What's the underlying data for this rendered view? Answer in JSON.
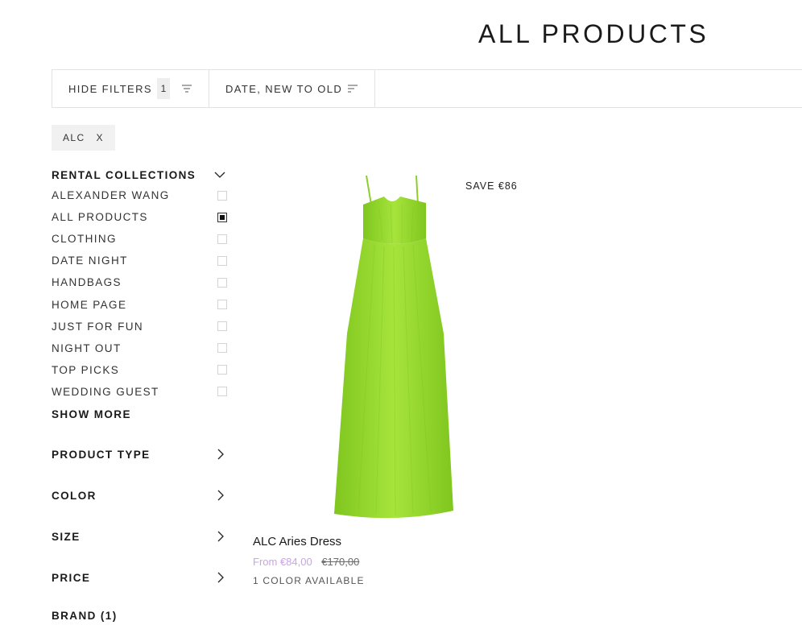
{
  "page": {
    "title": "ALL PRODUCTS"
  },
  "toolbar": {
    "hide_filters_label": "HIDE FILTERS",
    "filter_count": "1",
    "sort_label": "DATE, NEW TO OLD"
  },
  "active_filters": [
    {
      "label": "ALC",
      "remove": "X"
    }
  ],
  "sidebar": {
    "rental_collections": {
      "label": "RENTAL COLLECTIONS",
      "items": [
        {
          "label": "ALEXANDER WANG",
          "checked": false
        },
        {
          "label": "ALL PRODUCTS",
          "checked": true
        },
        {
          "label": "CLOTHING",
          "checked": false
        },
        {
          "label": "DATE NIGHT",
          "checked": false
        },
        {
          "label": "HANDBAGS",
          "checked": false
        },
        {
          "label": "HOME PAGE",
          "checked": false
        },
        {
          "label": "JUST FOR FUN",
          "checked": false
        },
        {
          "label": "NIGHT OUT",
          "checked": false
        },
        {
          "label": "TOP PICKS",
          "checked": false
        },
        {
          "label": "WEDDING GUEST",
          "checked": false
        }
      ],
      "show_more": "SHOW MORE"
    },
    "groups": [
      {
        "label": "PRODUCT TYPE"
      },
      {
        "label": "COLOR"
      },
      {
        "label": "SIZE"
      },
      {
        "label": "PRICE"
      },
      {
        "label": "BRAND (1)"
      }
    ]
  },
  "product": {
    "badge": "SAVE €86",
    "name": "ALC Aries Dress",
    "price_sale": "From €84,00",
    "price_original": "€170,00",
    "colors_available": "1 COLOR AVAILABLE",
    "image_color": "#a6e43c",
    "image_shade": "#7fc61e"
  },
  "colors": {
    "sale": "#c7a6e3",
    "text": "#1a1a1a",
    "border": "#e2e2e2"
  }
}
